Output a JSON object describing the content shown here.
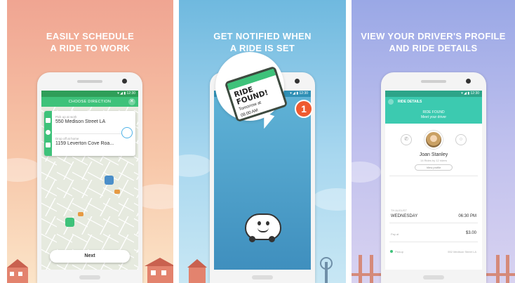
{
  "panels": [
    {
      "headline_line1": "EASILY SCHEDULE",
      "headline_line2": "A RIDE TO WORK",
      "phone": {
        "status": "▾ ◢ ▮ 12:30",
        "title": "CHOOSE DIRECTION",
        "close_icon": "close-icon",
        "pickup_label": "Pick up at work",
        "pickup_address": "550 Medison Street LA",
        "dropoff_label": "Drop off at home",
        "dropoff_address": "1159 Leverton Cove Roa...",
        "next_label": "Next"
      }
    },
    {
      "headline_line1": "GET NOTIFIED WHEN",
      "headline_line2": "A RIDE IS SET",
      "phone": {
        "status": "▾ ◢ ▮ 12:30",
        "card_line1": "RIDE",
        "card_line2": "FOUND!",
        "card_line3": "Tomorrow at",
        "card_line4": "08:00 AM",
        "badge_count": "1"
      }
    },
    {
      "headline_line1": "VIEW YOUR DRIVER'S PROFILE",
      "headline_line2": "AND RIDE DETAILS",
      "phone": {
        "status": "▾ ◢ ▮ 12:30",
        "title": "RIDE DETAILS",
        "found_line1": "RIDE FOUND",
        "found_line2": "Meet your driver",
        "driver_name": "Joan Stanley",
        "driver_sub": "14 Rides by 12 riders",
        "profile_button": "View profile",
        "date_label": "TH AUGUST",
        "day": "WEDNESDAY",
        "time": "06:30 PM",
        "price_label": "Pay at",
        "price": "$3.00",
        "pickup_label": "Pickup",
        "pickup_address": "552 Medison Street LA"
      }
    }
  ]
}
